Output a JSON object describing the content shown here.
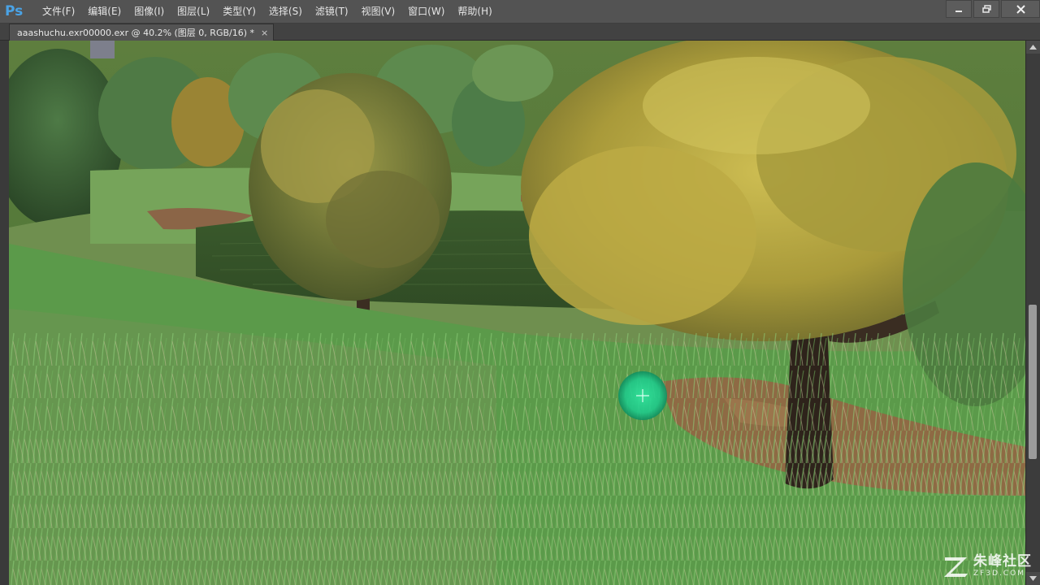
{
  "app": {
    "logo_text": "Ps"
  },
  "menu": [
    "文件(F)",
    "编辑(E)",
    "图像(I)",
    "图层(L)",
    "类型(Y)",
    "选择(S)",
    "滤镜(T)",
    "视图(V)",
    "窗口(W)",
    "帮助(H)"
  ],
  "window": {
    "minimize_icon": "minimize-icon",
    "restore_icon": "restore-icon",
    "close_icon": "close-icon"
  },
  "document_tab": {
    "title": "aaashuchu.exr00000.exr @ 40.2% (图层 0, RGB/16) *",
    "close_glyph": "×"
  },
  "canvas": {
    "cursor_icon": "crosshair-brush-cursor",
    "brush_color": "#1fd68a"
  },
  "watermark": {
    "title": "朱峰社区",
    "url": "ZF3D.COM"
  },
  "colors": {
    "menubar": "#535353",
    "ps_blue": "#4aa3e6",
    "grass": "#5d9a48",
    "foliage": "#b9a83c"
  }
}
